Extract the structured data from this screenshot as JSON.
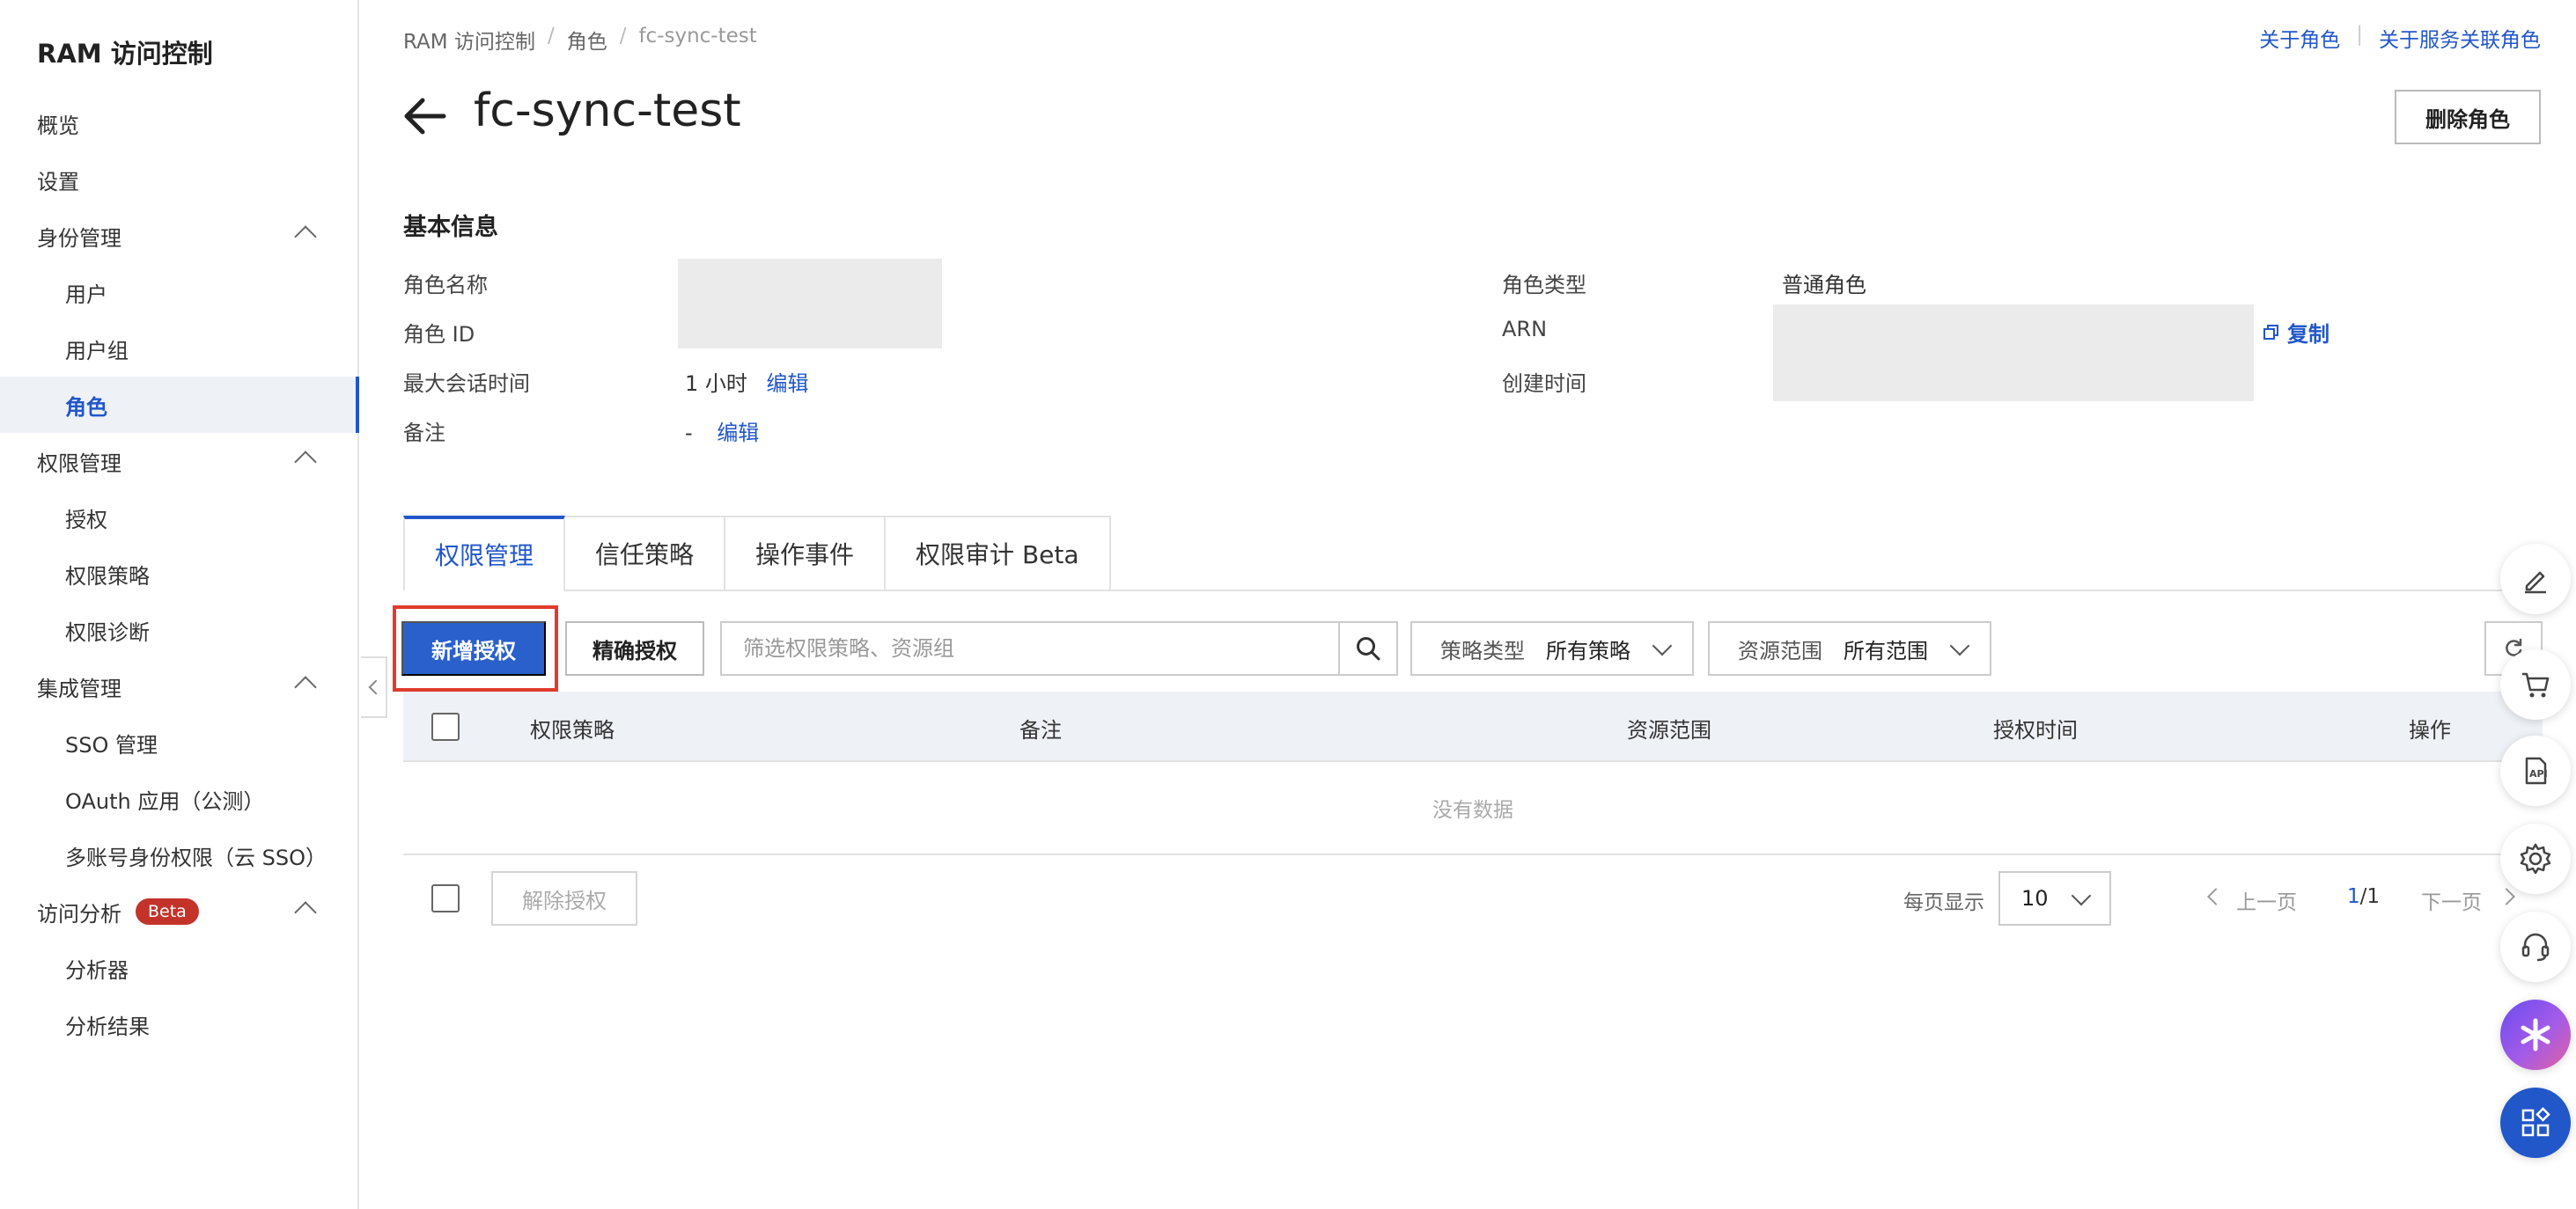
{
  "sidebar": {
    "title": "RAM 访问控制",
    "items": [
      {
        "label": "概览"
      },
      {
        "label": "设置"
      },
      {
        "label": "身份管理"
      },
      {
        "label": "用户"
      },
      {
        "label": "用户组"
      },
      {
        "label": "角色"
      },
      {
        "label": "权限管理"
      },
      {
        "label": "授权"
      },
      {
        "label": "权限策略"
      },
      {
        "label": "权限诊断"
      },
      {
        "label": "集成管理"
      },
      {
        "label": "SSO 管理"
      },
      {
        "label": "OAuth 应用（公测）"
      },
      {
        "label": "多账号身份权限（云 SSO）"
      },
      {
        "label": "访问分析",
        "badge": "Beta"
      },
      {
        "label": "分析器"
      },
      {
        "label": "分析结果"
      }
    ]
  },
  "breadcrumb": [
    "RAM 访问控制",
    "角色",
    "fc-sync-test"
  ],
  "top_links": [
    "关于角色",
    "关于服务关联角色"
  ],
  "page": {
    "title": "fc-sync-test",
    "delete_label": "删除角色"
  },
  "basic_info": {
    "title": "基本信息",
    "role_name_label": "角色名称",
    "role_id_label": "角色 ID",
    "max_session_label": "最大会话时间",
    "max_session_value": "1 小时",
    "edit_label": "编辑",
    "remark_label": "备注",
    "remark_value": "-",
    "role_type_label": "角色类型",
    "role_type_value": "普通角色",
    "arn_label": "ARN",
    "copy_label": "复制",
    "created_label": "创建时间"
  },
  "tabs": [
    "权限管理",
    "信任策略",
    "操作事件",
    "权限审计 Beta"
  ],
  "toolbar": {
    "add_label": "新增授权",
    "precise_label": "精确授权",
    "search_placeholder": "筛选权限策略、资源组",
    "policy_type_label": "策略类型",
    "policy_type_value": "所有策略",
    "scope_label": "资源范围",
    "scope_value": "所有范围"
  },
  "table": {
    "columns": [
      "权限策略",
      "备注",
      "资源范围",
      "授权时间",
      "操作"
    ],
    "empty_text": "没有数据"
  },
  "footer": {
    "revoke_label": "解除授权",
    "per_page_label": "每页显示",
    "per_page_value": "10",
    "prev_label": "上一页",
    "page_current": "1",
    "page_total": "/1",
    "next_label": "下一页"
  },
  "colors": {
    "accent": "#2157c9",
    "primary_button": "#2a60cc",
    "highlight_border": "#e03b2c",
    "beta_badge": "#c4332a"
  }
}
